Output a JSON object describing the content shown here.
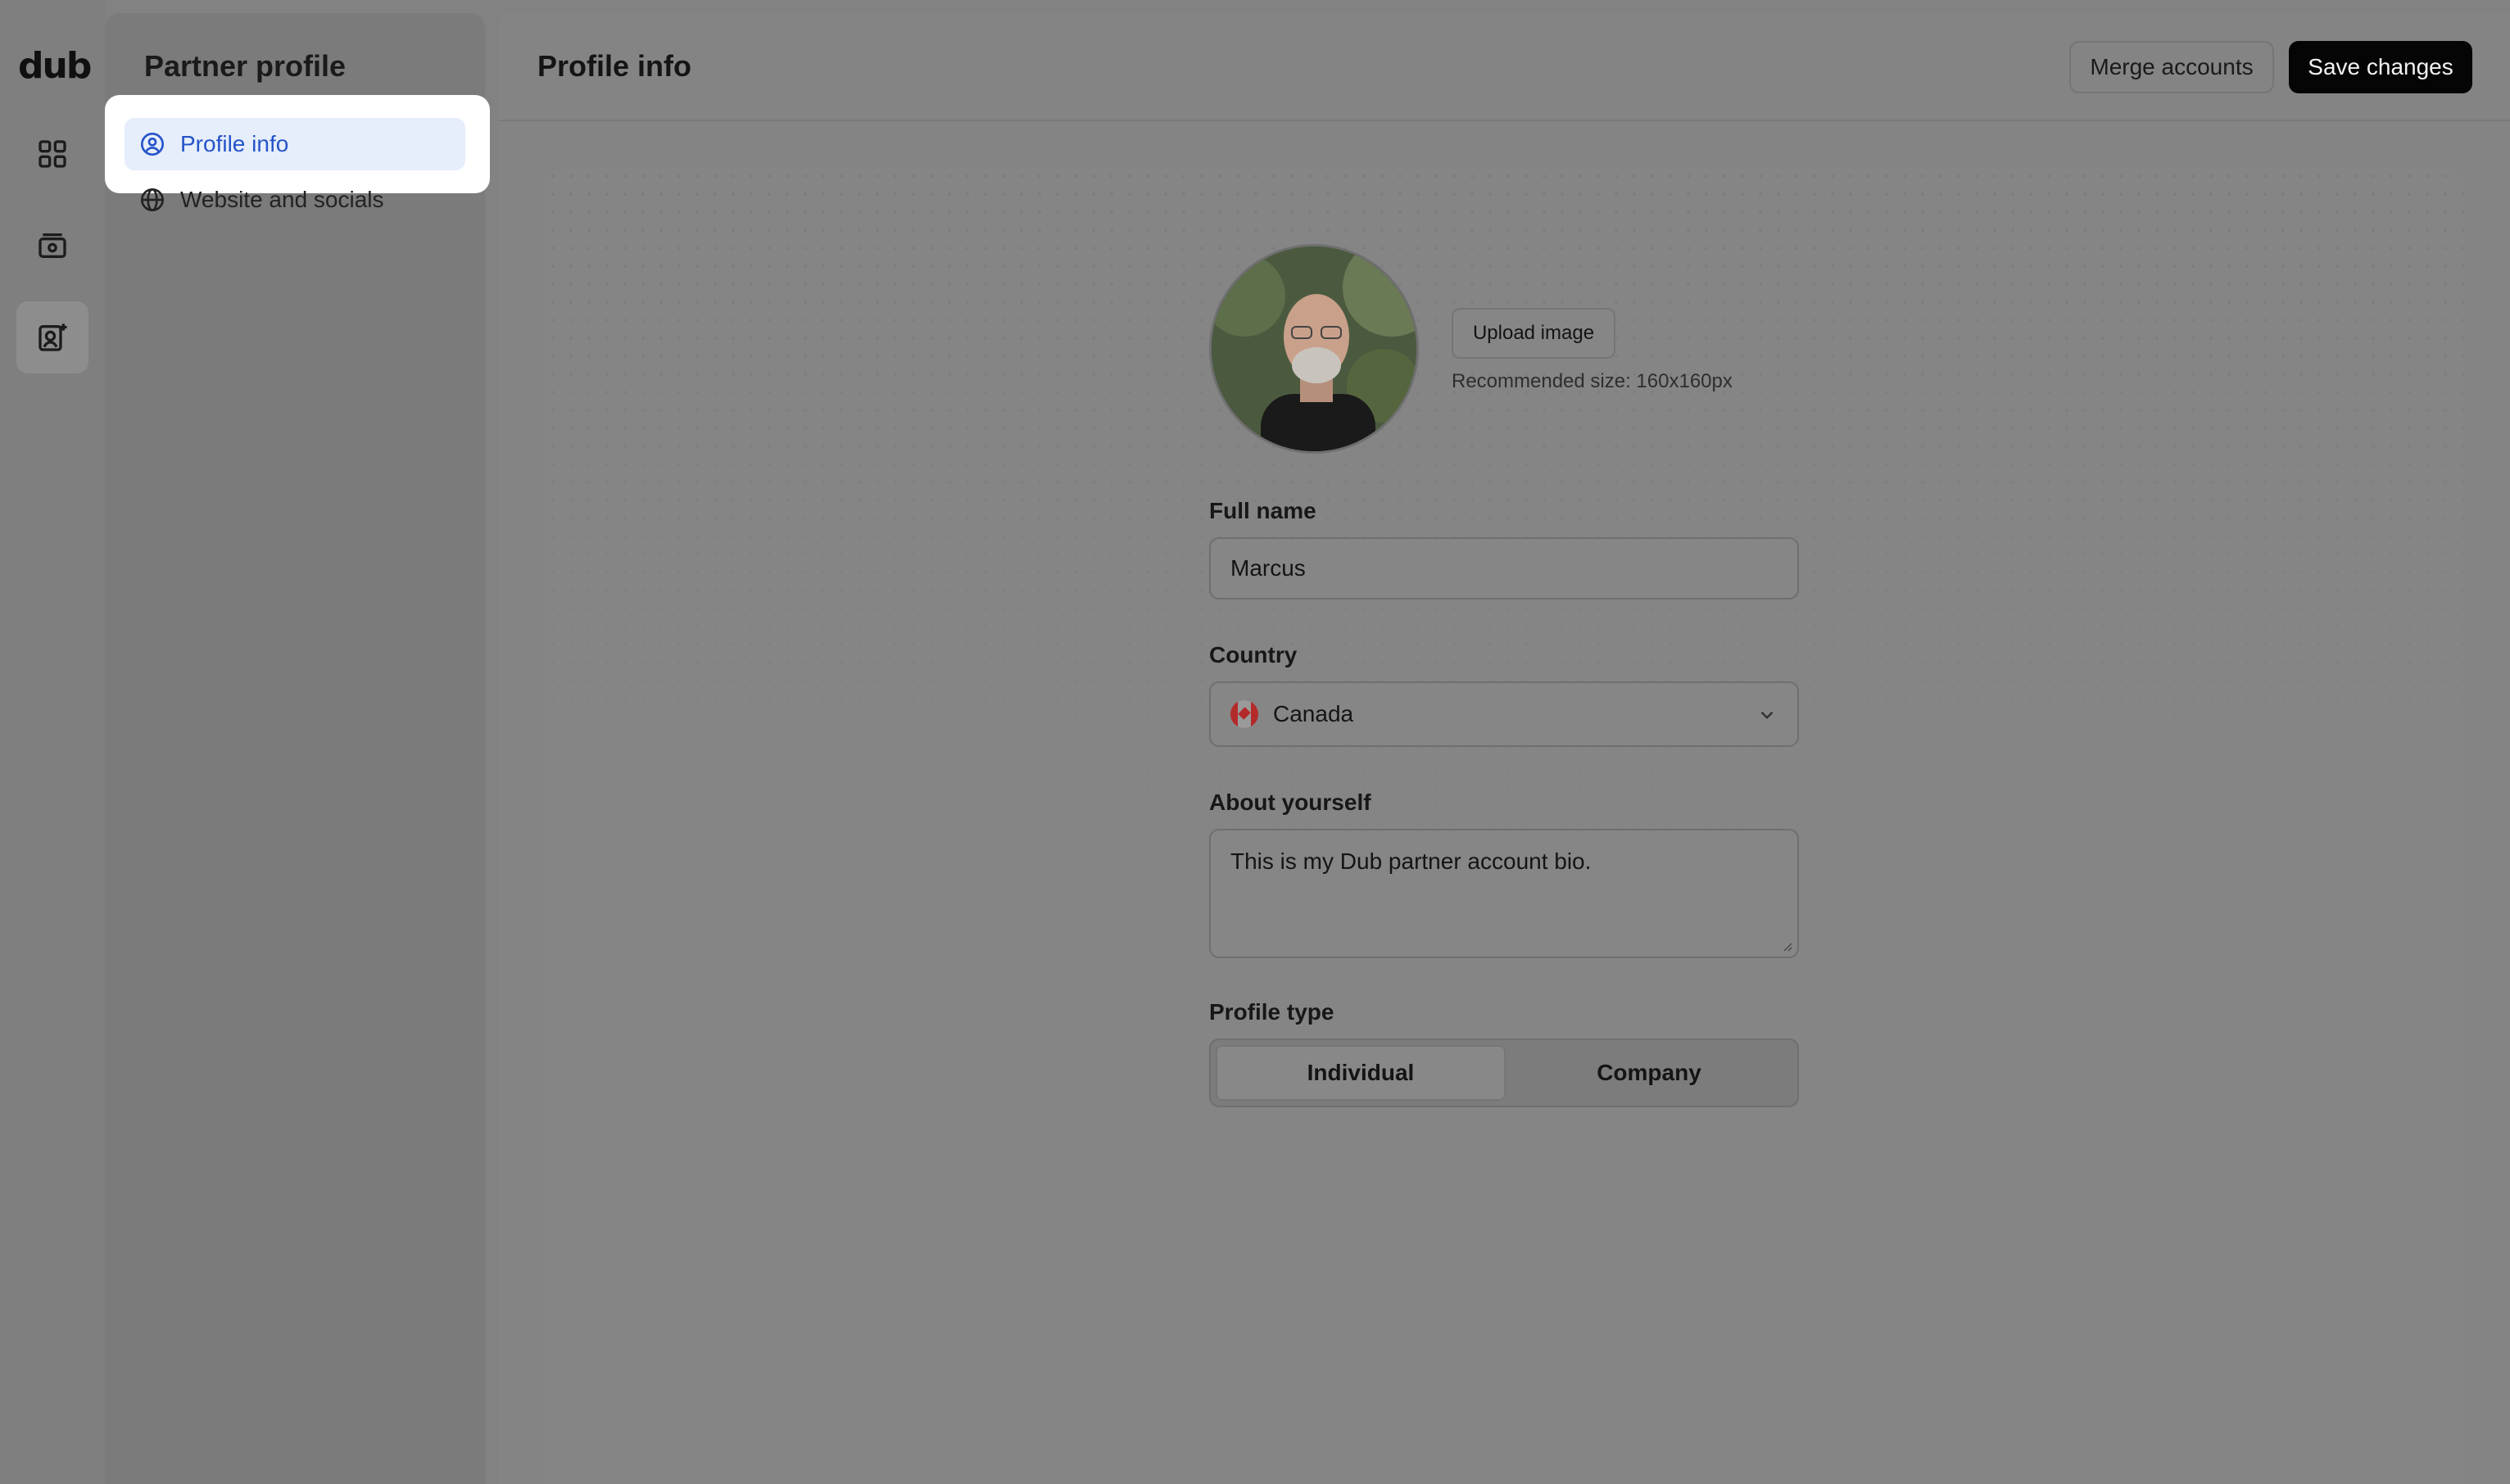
{
  "app": {
    "logo_text": "dub"
  },
  "rail": {
    "items": [
      {
        "icon": "grid-icon",
        "active": false
      },
      {
        "icon": "money-icon",
        "active": false
      },
      {
        "icon": "user-profile-plus-icon",
        "active": true
      }
    ]
  },
  "sidebar": {
    "title": "Partner profile",
    "items": [
      {
        "label": "Profile info",
        "icon": "user-circle-icon",
        "active": true
      },
      {
        "label": "Website and socials",
        "icon": "globe-icon",
        "active": false
      }
    ]
  },
  "header": {
    "title": "Profile info",
    "merge_label": "Merge accounts",
    "save_label": "Save changes"
  },
  "form": {
    "upload_label": "Upload image",
    "upload_hint": "Recommended size: 160x160px",
    "full_name": {
      "label": "Full name",
      "value": "Marcus"
    },
    "country": {
      "label": "Country",
      "value": "Canada"
    },
    "about": {
      "label": "About yourself",
      "value": "This is my Dub partner account bio."
    },
    "profile_type": {
      "label": "Profile type",
      "options": [
        "Individual",
        "Company"
      ],
      "selected": "Individual"
    }
  },
  "colors": {
    "active_nav_bg": "#e6eefb",
    "active_nav_text": "#2553c9",
    "primary_button": "#050505"
  }
}
